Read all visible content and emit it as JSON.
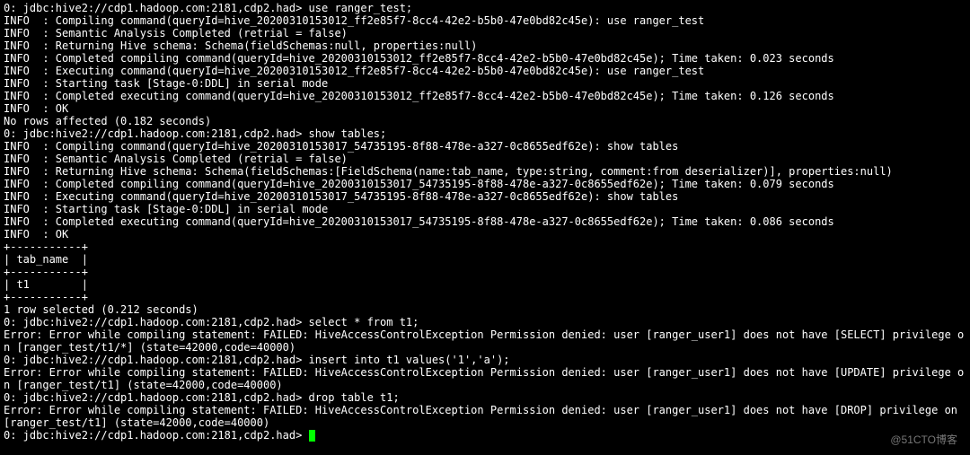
{
  "lines": [
    "0: jdbc:hive2://cdp1.hadoop.com:2181,cdp2.had> use ranger_test;",
    "INFO  : Compiling command(queryId=hive_20200310153012_ff2e85f7-8cc4-42e2-b5b0-47e0bd82c45e): use ranger_test",
    "INFO  : Semantic Analysis Completed (retrial = false)",
    "INFO  : Returning Hive schema: Schema(fieldSchemas:null, properties:null)",
    "INFO  : Completed compiling command(queryId=hive_20200310153012_ff2e85f7-8cc4-42e2-b5b0-47e0bd82c45e); Time taken: 0.023 seconds",
    "INFO  : Executing command(queryId=hive_20200310153012_ff2e85f7-8cc4-42e2-b5b0-47e0bd82c45e): use ranger_test",
    "INFO  : Starting task [Stage-0:DDL] in serial mode",
    "INFO  : Completed executing command(queryId=hive_20200310153012_ff2e85f7-8cc4-42e2-b5b0-47e0bd82c45e); Time taken: 0.126 seconds",
    "INFO  : OK",
    "No rows affected (0.182 seconds)",
    "0: jdbc:hive2://cdp1.hadoop.com:2181,cdp2.had> show tables;",
    "INFO  : Compiling command(queryId=hive_20200310153017_54735195-8f88-478e-a327-0c8655edf62e): show tables",
    "INFO  : Semantic Analysis Completed (retrial = false)",
    "INFO  : Returning Hive schema: Schema(fieldSchemas:[FieldSchema(name:tab_name, type:string, comment:from deserializer)], properties:null)",
    "INFO  : Completed compiling command(queryId=hive_20200310153017_54735195-8f88-478e-a327-0c8655edf62e); Time taken: 0.079 seconds",
    "INFO  : Executing command(queryId=hive_20200310153017_54735195-8f88-478e-a327-0c8655edf62e): show tables",
    "INFO  : Starting task [Stage-0:DDL] in serial mode",
    "INFO  : Completed executing command(queryId=hive_20200310153017_54735195-8f88-478e-a327-0c8655edf62e); Time taken: 0.086 seconds",
    "INFO  : OK",
    "+-----------+",
    "| tab_name  |",
    "+-----------+",
    "| t1        |",
    "+-----------+",
    "1 row selected (0.212 seconds)",
    "0: jdbc:hive2://cdp1.hadoop.com:2181,cdp2.had> select * from t1;",
    "Error: Error while compiling statement: FAILED: HiveAccessControlException Permission denied: user [ranger_user1] does not have [SELECT] privilege on [ranger_test/t1/*] (state=42000,code=40000)",
    "0: jdbc:hive2://cdp1.hadoop.com:2181,cdp2.had> insert into t1 values('1','a');",
    "Error: Error while compiling statement: FAILED: HiveAccessControlException Permission denied: user [ranger_user1] does not have [UPDATE] privilege on [ranger_test/t1] (state=42000,code=40000)",
    "0: jdbc:hive2://cdp1.hadoop.com:2181,cdp2.had> drop table t1;",
    "Error: Error while compiling statement: FAILED: HiveAccessControlException Permission denied: user [ranger_user1] does not have [DROP] privilege on [ranger_test/t1] (state=42000,code=40000)",
    "0: jdbc:hive2://cdp1.hadoop.com:2181,cdp2.had> "
  ],
  "watermark": "@51CTO博客"
}
